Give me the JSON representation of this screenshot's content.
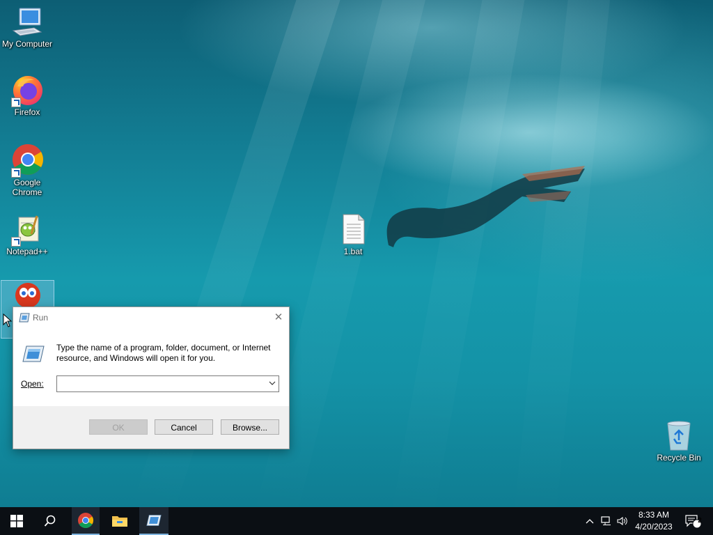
{
  "desktop": {
    "icons": [
      {
        "label": "My Computer",
        "icon": "computer-icon"
      },
      {
        "label": "Firefox",
        "icon": "firefox-icon"
      },
      {
        "label": "Google Chrome",
        "icon": "chrome-icon"
      },
      {
        "label": "Notepad++",
        "icon": "notepadpp-icon"
      },
      {
        "label": "1.bat",
        "icon": "batch-file-icon"
      },
      {
        "label": "Recycle Bin",
        "icon": "recycle-bin-icon"
      }
    ]
  },
  "run_dialog": {
    "title": "Run",
    "message": "Type the name of a program, folder, document, or Internet resource, and Windows will open it for you.",
    "open_label": "Open:",
    "open_value": "",
    "ok_label": "OK",
    "cancel_label": "Cancel",
    "browse_label": "Browse..."
  },
  "taskbar": {
    "time": "8:33 AM",
    "date": "4/20/2023",
    "notification_count": "2",
    "pinned": [
      "start-icon",
      "search-icon",
      "chrome-icon",
      "file-explorer-icon",
      "run-icon"
    ]
  },
  "colors": {
    "taskbar_bg": "#0b0f14",
    "dialog_footer": "#f0f0f0",
    "active_indicator": "#7fb5e0"
  }
}
